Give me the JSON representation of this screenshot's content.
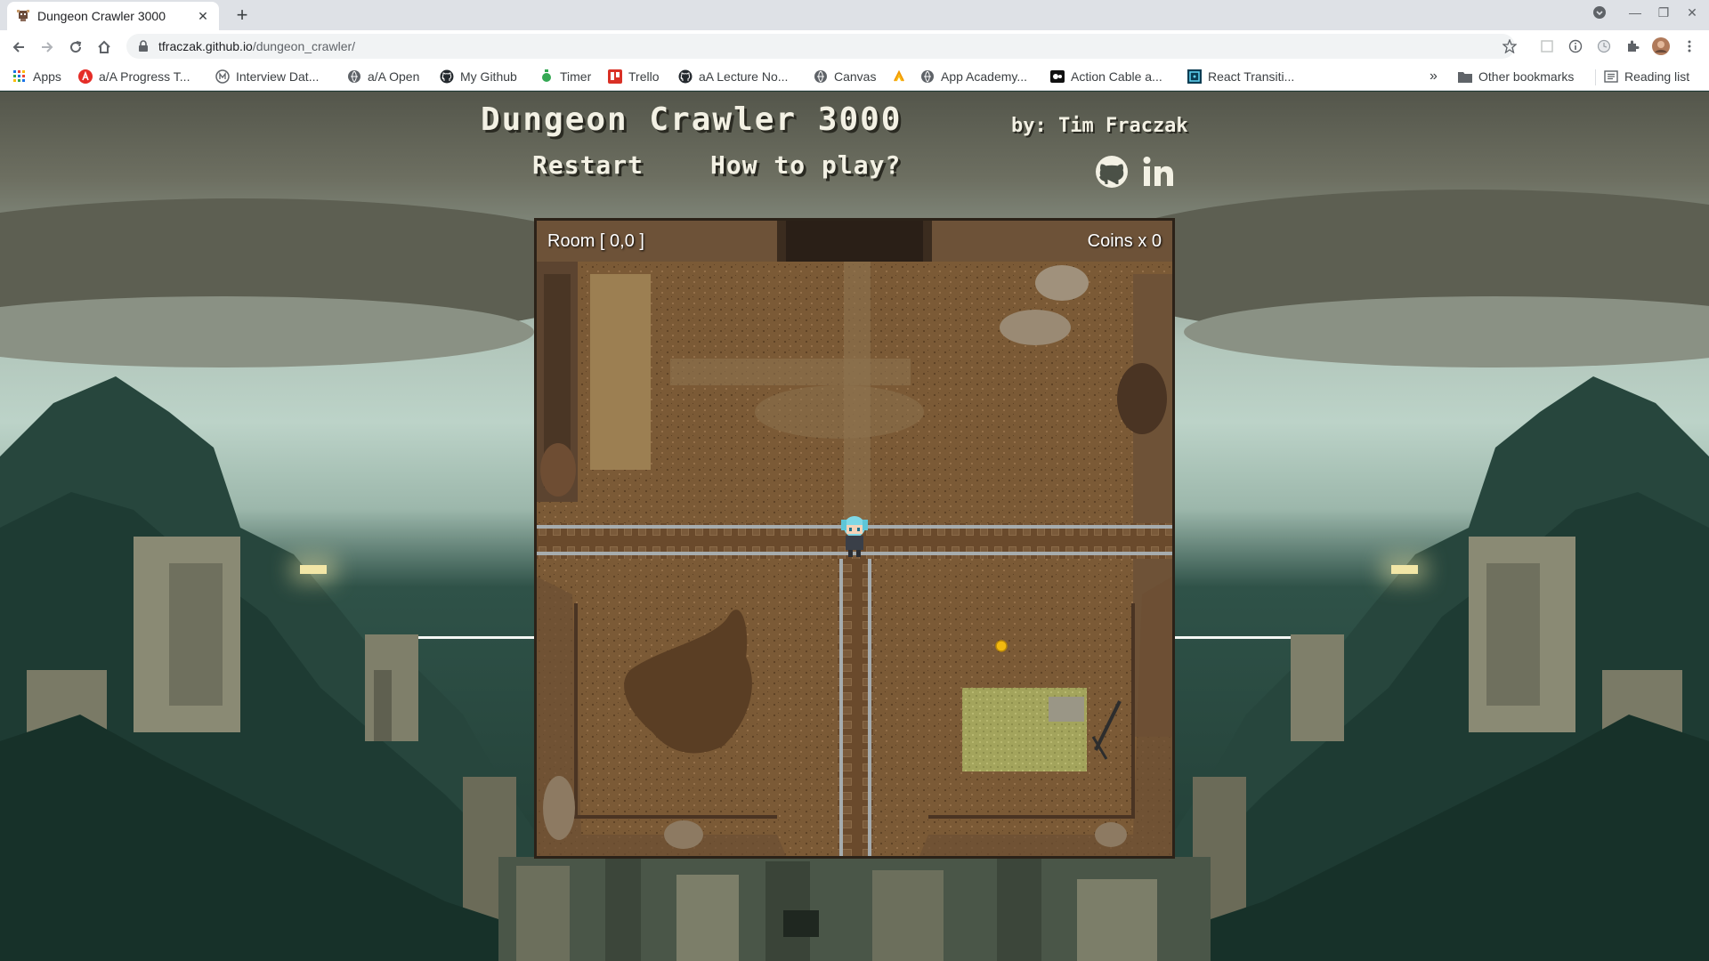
{
  "browser": {
    "tab_title": "Dungeon Crawler 3000",
    "url_host": "tfraczak.github.io",
    "url_path": "/dungeon_crawler/",
    "bookmarks": [
      {
        "label": "Apps",
        "icon": "apps-grid-icon"
      },
      {
        "label": "a/A Progress T...",
        "icon": "appacademy-a-icon"
      },
      {
        "label": "Interview Dat...",
        "icon": "interview-icon"
      },
      {
        "label": "a/A Open",
        "icon": "globe-icon"
      },
      {
        "label": "My Github",
        "icon": "github-icon"
      },
      {
        "label": "Timer",
        "icon": "timer-icon"
      },
      {
        "label": "Trello",
        "icon": "trello-icon"
      },
      {
        "label": "aA Lecture No...",
        "icon": "github-icon"
      },
      {
        "label": "Canvas",
        "icon": "globe-icon"
      },
      {
        "label": "",
        "icon": "rss-icon"
      },
      {
        "label": "App Academy...",
        "icon": "globe-icon"
      },
      {
        "label": "Action Cable a...",
        "icon": "action-cable-icon"
      },
      {
        "label": "React Transiti...",
        "icon": "react-icon"
      }
    ],
    "overflow_label": "»",
    "other_bookmarks": "Other bookmarks",
    "reading_list": "Reading list"
  },
  "page": {
    "title": "Dungeon Crawler 3000",
    "byline": "by: Tim Fraczak",
    "restart_label": "Restart",
    "how_to_play_label": "How to play?"
  },
  "game": {
    "room_label": "Room [ 0,0 ]",
    "coins_label": "Coins x 0"
  },
  "colors": {
    "title_text": "#f3f1e4",
    "dirt": "#7a5a35",
    "forest": "#1f3a32",
    "coin": "#f2b90f"
  }
}
